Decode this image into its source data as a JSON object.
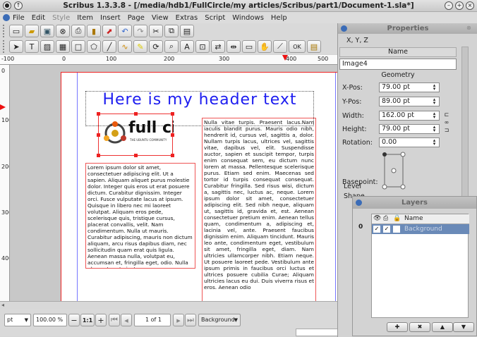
{
  "window": {
    "title": "Scribus 1.3.3.8 - [/media/hdb1/FullCircle/my articles/Scribus/part1/Document-1.sla*]"
  },
  "menu": [
    "File",
    "Edit",
    "Style",
    "Item",
    "Insert",
    "Page",
    "View",
    "Extras",
    "Script",
    "Windows",
    "Help"
  ],
  "menu_disabled": [
    "Style"
  ],
  "toolbar": {
    "ok_label": "OK"
  },
  "ruler": {
    "h_ticks": [
      "-100",
      "0",
      "100",
      "200",
      "300",
      "400",
      "500"
    ],
    "v_ticks": [
      "0",
      "100",
      "200",
      "300",
      "400"
    ]
  },
  "document": {
    "header_text": "Here is my header text",
    "logo_text": "full circ",
    "logo_tag": "THE UBUNTU COMMUNITY",
    "left_text": "Lorem ipsum dolor sit amet, consectetuer adipiscing elit. Ut a sapien. Aliquam aliquet purus molestie dolor. Integer quis eros ut erat posuere dictum. Curabitur dignissim. Integer orci. Fusce vulputate lacus at ipsum. Quisque in libero nec mi laoreet volutpat. Aliquam eros pede, scelerisque quis, tristique cursus, placerat convallis, velit. Nam condimentum. Nulla ut mauris. Curabitur adipiscing, mauris non dictum aliquam, arcu risus dapibus diam, nec sollicitudin quam erat quis ligula. Aenean massa nulla, volutpat eu, accumsan et, fringilla eget, odio. Nulla placerat porta justo.",
    "right_text": "Nulla vitae turpis. Praesent lacus.Nam iaculis blandit purus. Mauris odio nibh, hendrerit id, cursus vel, sagittis a, dolor. Nullam turpis lacus, ultrices vel, sagittis vitae, dapibus vel, elit. Suspendisse auctor, sapien et suscipit tempor, turpis enim consequat sem, eu dictum nunc lorem at massa. Pellentesque scelerisque purus. Etiam sed enim. Maecenas sed tortor id turpis consequat consequat. Curabitur fringilla. Sed risus wisi, dictum a, sagittis nec, luctus ac, neque. Lorem ipsum dolor sit amet, consectetuer adipiscing elit. Sed nibh neque, aliquam ut, sagittis id, gravida et, est. Aenean consectetuer pretium enim. Aenean tellus quam, condimentum a, adipiscing et, lacinia vel, ante. Praesent faucibus dignissim enim. Aliquam tincidunt. Mauris leo ante, condimentum eget, vestibulum sit amet, fringilla eget, diam. Nam ultricies ullamcorper nibh. Etiam neque. Ut posuere laoreet pede. Vestibulum ante ipsum primis in faucibus orci luctus et ultrices posuere cubilia Curae; Aliquam ultricies lacus eu dui. Duis viverra risus et eros. Aenean odio"
  },
  "status": {
    "unit": "pt",
    "zoom": "100.00 %",
    "ratio": "1:1",
    "page": "1 of 1",
    "layer": "Background"
  },
  "properties": {
    "title": "Properties",
    "tab": "X, Y, Z",
    "name_header": "Name",
    "name_value": "Image4",
    "geometry_header": "Geometry",
    "xpos_label": "X-Pos:",
    "xpos": "79.00 pt",
    "ypos_label": "Y-Pos:",
    "ypos": "89.00 pt",
    "width_label": "Width:",
    "width": "162.00 pt",
    "height_label": "Height:",
    "height": "79.00 pt",
    "rotation_label": "Rotation:",
    "rotation": "0.00",
    "basepoint_label": "Basepoint:",
    "level_label": "Level",
    "shape_label": "Shape"
  },
  "layers": {
    "title": "Layers",
    "col_name": "Name",
    "row_index": "0",
    "row_name": "Background"
  }
}
